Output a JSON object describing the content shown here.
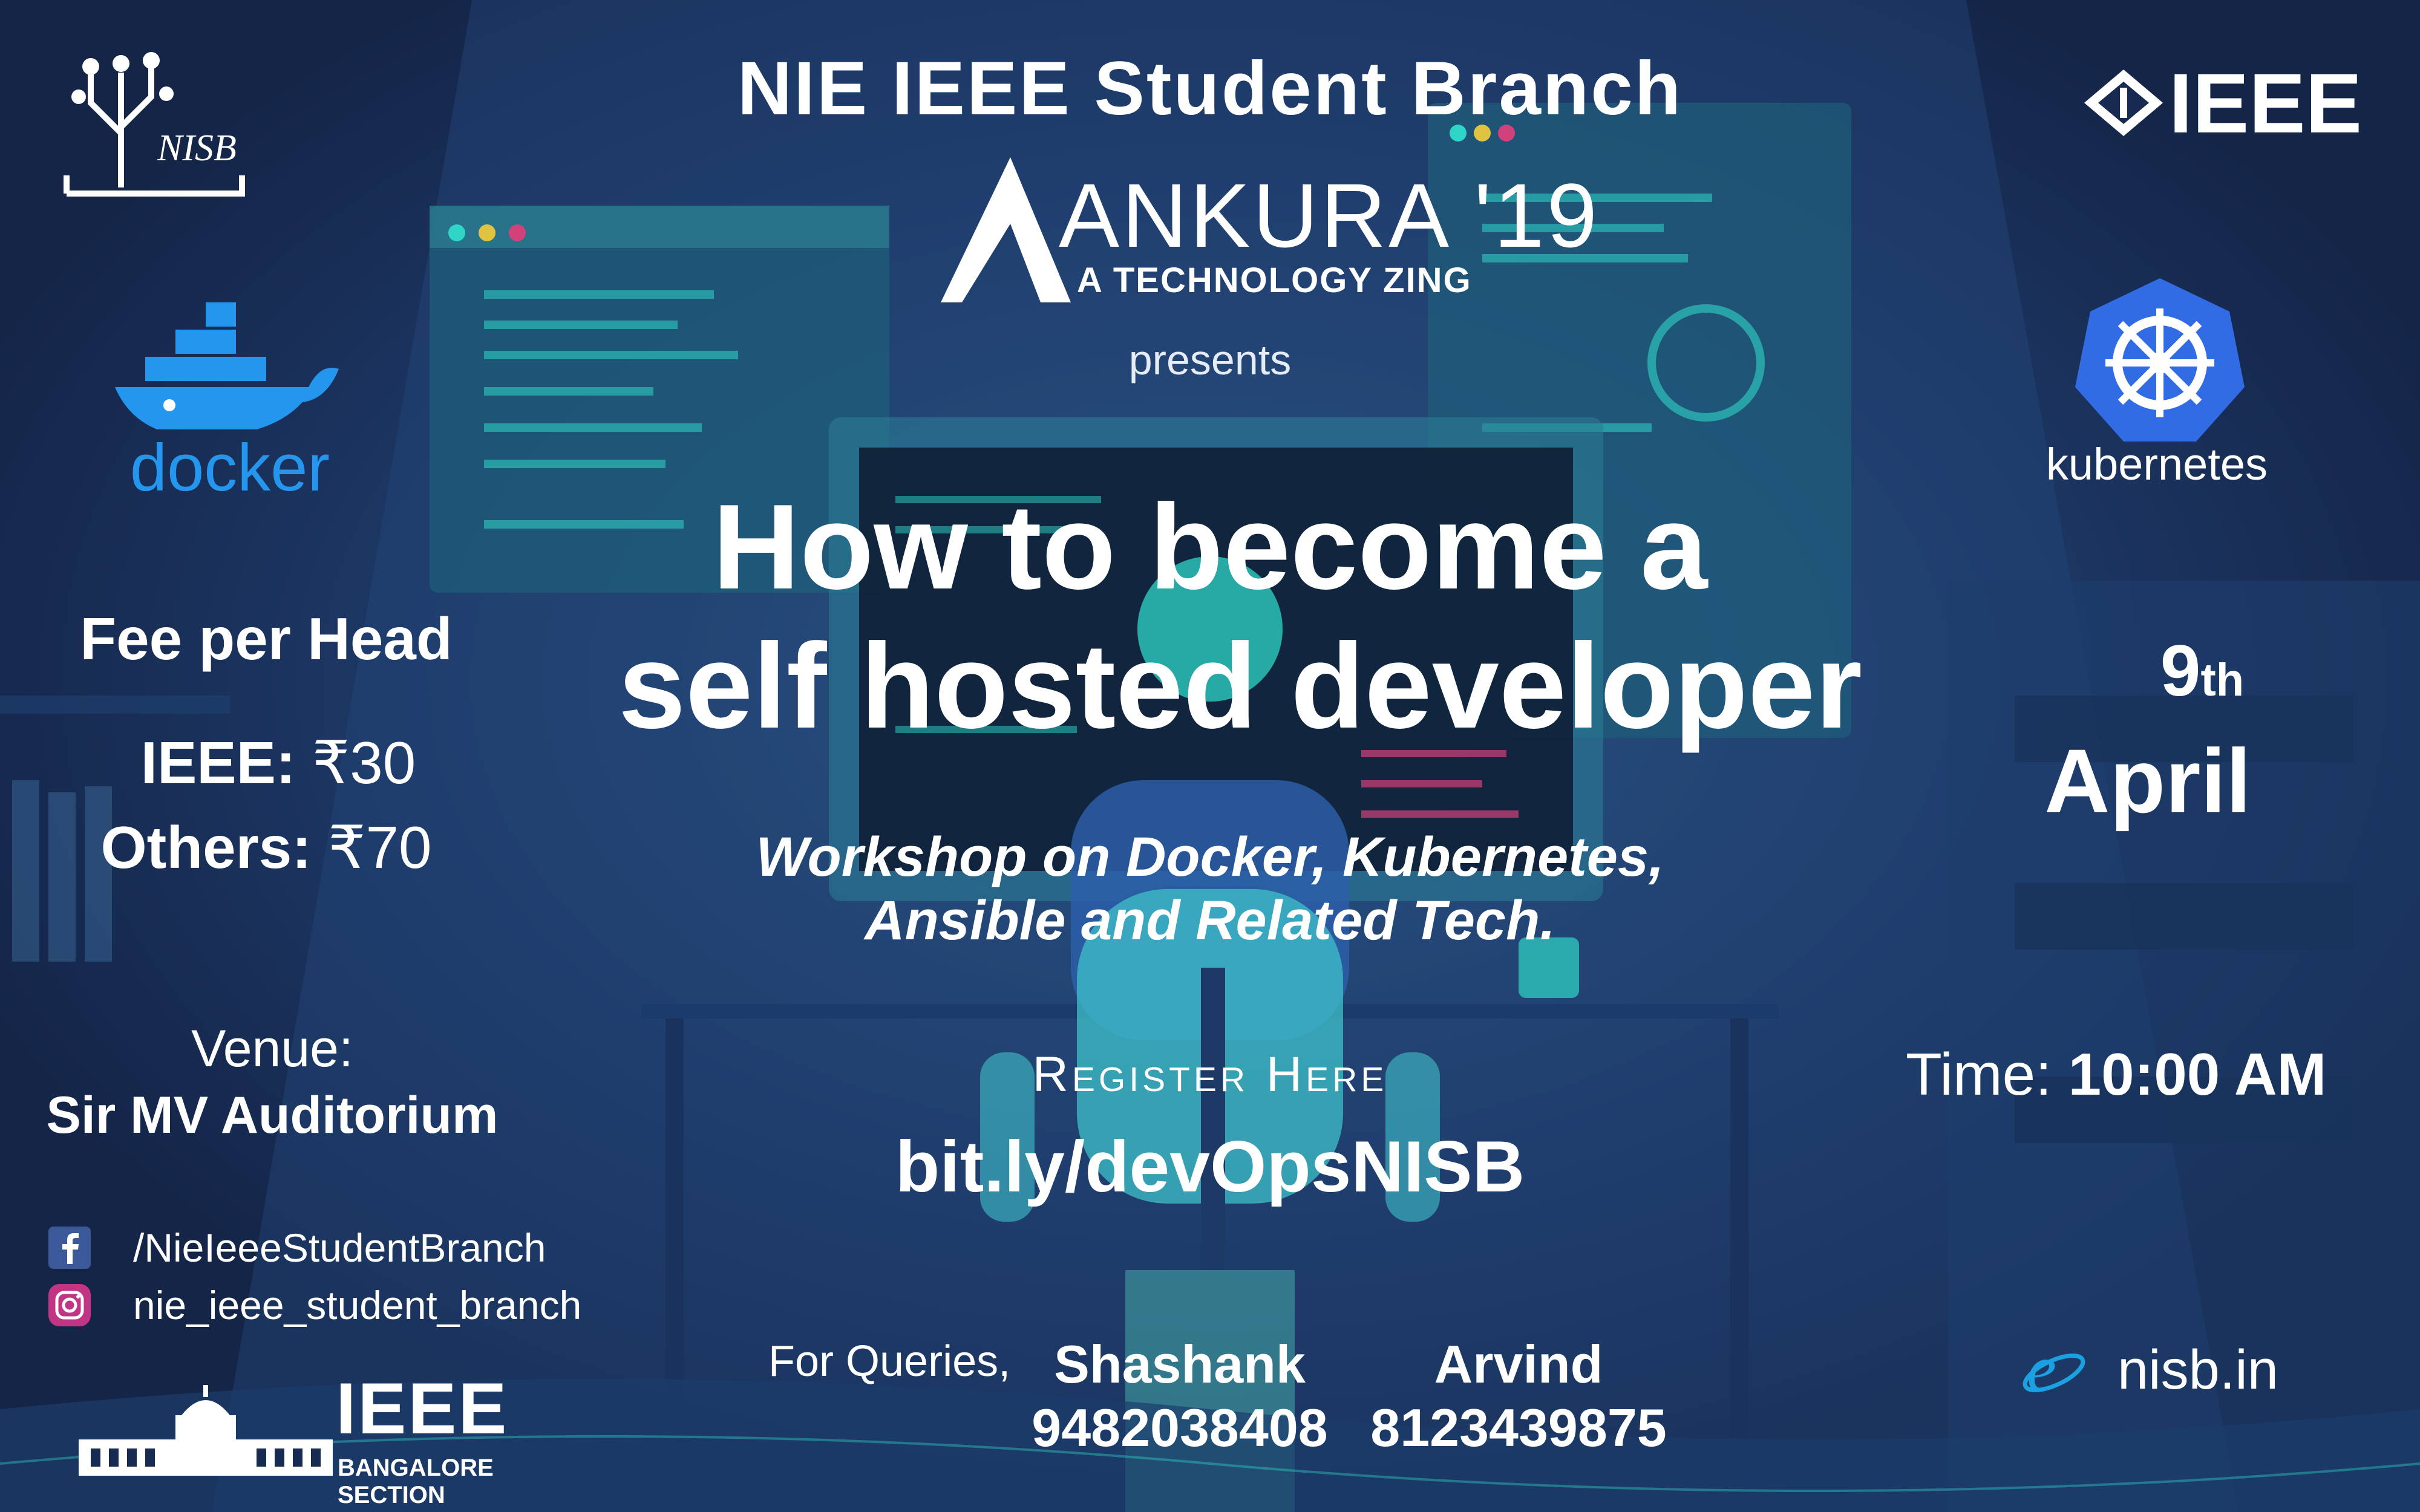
{
  "header": {
    "branch": "NIE IEEE Student Branch",
    "event_title": "ANKURA '19",
    "event_subtitle": "A TECHNOLOGY ZING",
    "presents": "presents"
  },
  "headline": {
    "line1": "How to become a",
    "line2": "self hosted developer"
  },
  "subheadline": {
    "line1": "Workshop on Docker, Kubernetes,",
    "line2": "Ansible and Related Tech."
  },
  "registration": {
    "label": "Register Here",
    "link": "bit.ly/devOpsNISB"
  },
  "logos": {
    "nisb": "NISB",
    "docker": "docker",
    "ieee": "IEEE",
    "kubernetes": "kubernetes",
    "ieee_bangalore_top": "IEEE",
    "ieee_bangalore_bottom": "BANGALORE SECTION"
  },
  "fees": {
    "heading": "Fee per Head",
    "ieee_label": "IEEE:",
    "ieee_value": "₹30",
    "others_label": "Others:",
    "others_value": "₹70"
  },
  "venue": {
    "label": "Venue:",
    "name": "Sir MV Auditorium"
  },
  "social": {
    "facebook": "/NieIeeeStudentBranch",
    "instagram": "nie_ieee_student_branch",
    "website": "nisb.in"
  },
  "date": {
    "day": "9",
    "suffix": "th",
    "month": "April"
  },
  "time": {
    "label": "Time:",
    "value": "10:00 AM"
  },
  "queries": {
    "label": "For Queries,",
    "contacts": [
      {
        "name": "Shashank",
        "phone": "9482038408"
      },
      {
        "name": "Arvind",
        "phone": "8123439875"
      }
    ]
  },
  "colors": {
    "background": "#162a52",
    "accent_cyan": "#2fd6c8",
    "docker_blue": "#2496ed",
    "kubernetes_blue": "#326ce5"
  }
}
